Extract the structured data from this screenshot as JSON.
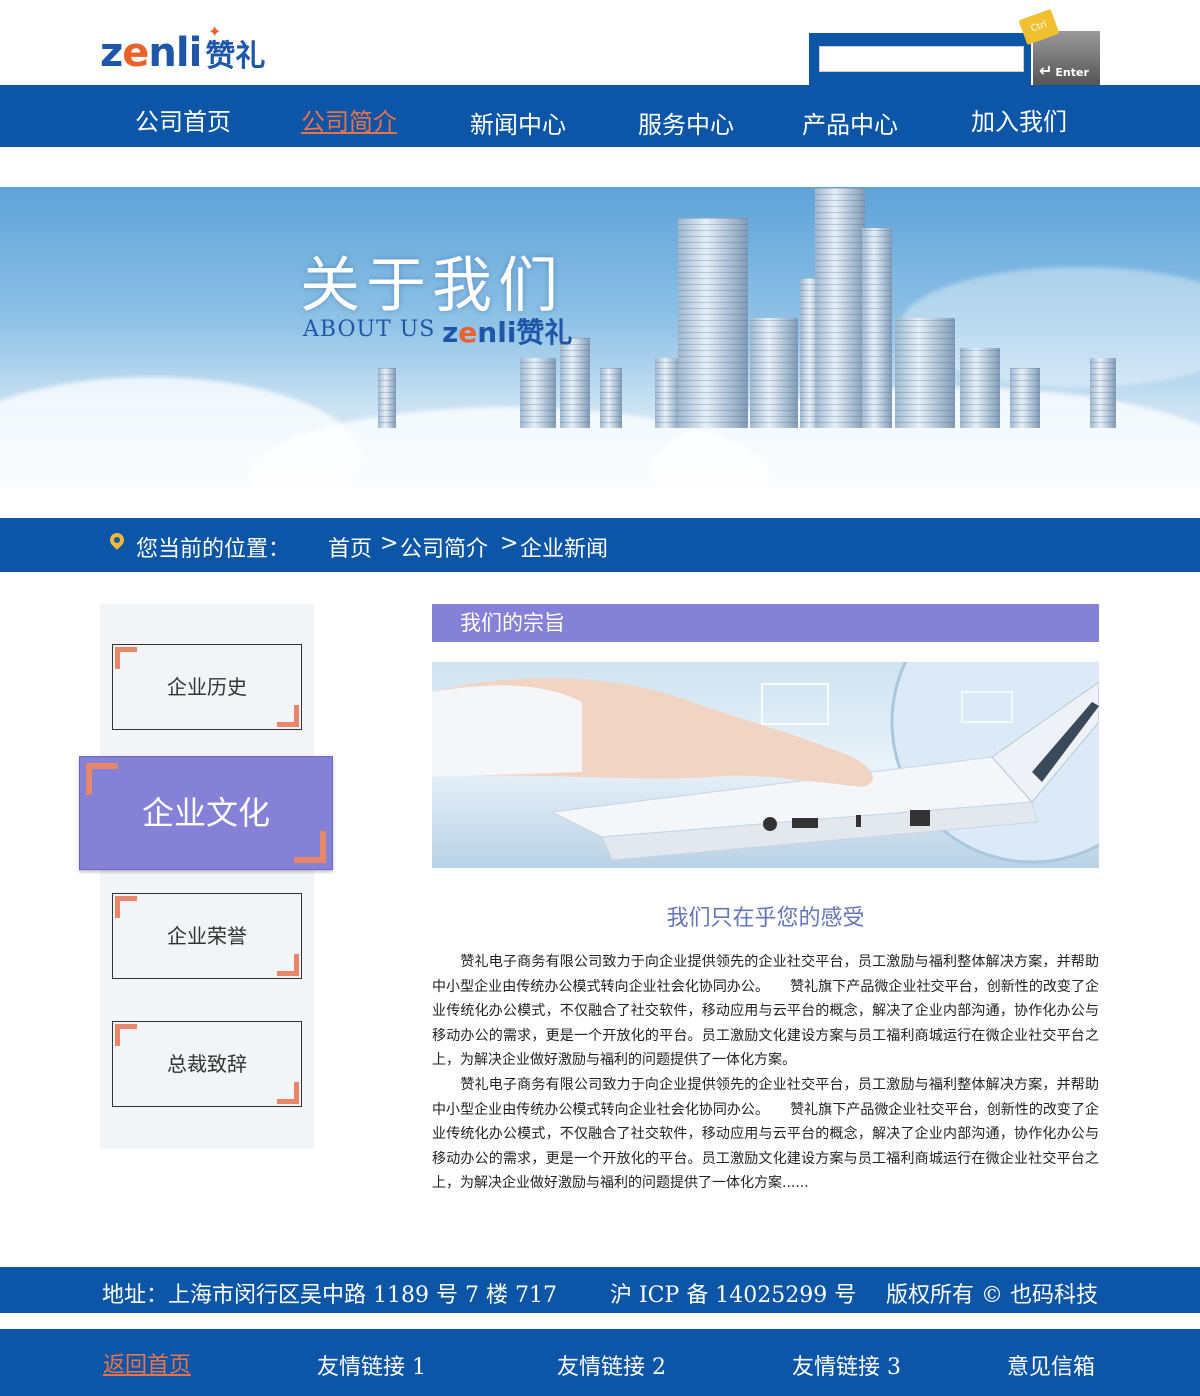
{
  "header": {
    "logo_en_pre": "z",
    "logo_en_ring": "e",
    "logo_en_post": "nli",
    "logo_cn": "赞礼",
    "search_placeholder": "",
    "ctrl_label": "Ctrl",
    "enter_label": "Enter"
  },
  "nav": {
    "items": [
      {
        "label": "公司首页"
      },
      {
        "label": "公司简介"
      },
      {
        "label": "新闻中心"
      },
      {
        "label": "服务中心"
      },
      {
        "label": "产品中心"
      },
      {
        "label": "加入我们"
      }
    ],
    "active_index": 1
  },
  "banner": {
    "title": "关于我们",
    "about": "ABOUT US",
    "logo_pre": "z",
    "logo_ring": "e",
    "logo_post": "nli赞礼"
  },
  "breadcrumb": {
    "label": "您当前的位置：",
    "items": [
      "首页",
      "公司简介",
      "企业新闻"
    ],
    "separator": ">"
  },
  "sidebar": {
    "items": [
      "企业历史",
      "企业文化",
      "企业荣誉",
      "总裁致辞"
    ],
    "active_index": 1
  },
  "content": {
    "section_title": "我们的宗旨",
    "subtitle": "我们只在乎您的感受",
    "paragraphs": [
      "　　赞礼电子商务有限公司致力于向企业提供领先的企业社交平台，员工激励与福利整体解决方案，并帮助中小型企业由传统办公模式转向企业社会化协同办公。　　赞礼旗下产品微企业社交平台，创新性的改变了企业传统化办公模式，不仅融合了社交软件，移动应用与云平台的概念，解决了企业内部沟通，协作化办公与移动办公的需求，更是一个开放化的平台。员工激励文化建设方案与员工福利商城运行在微企业社交平台之上，为解决企业做好激励与福利的问题提供了一体化方案。",
      "　　赞礼电子商务有限公司致力于向企业提供领先的企业社交平台，员工激励与福利整体解决方案，并帮助中小型企业由传统办公模式转向企业社会化协同办公。　　赞礼旗下产品微企业社交平台，创新性的改变了企业传统化办公模式，不仅融合了社交软件，移动应用与云平台的概念，解决了企业内部沟通，协作化办公与移动办公的需求，更是一个开放化的平台。员工激励文化建设方案与员工福利商城运行在微企业社交平台之上，为解决企业做好激励与福利的问题提供了一体化方案......"
    ]
  },
  "footer": {
    "address": "地址：上海市闵行区吴中路 1189 号 7 楼 717",
    "icp": "沪 ICP 备 14025299 号",
    "copyright": "版权所有 © 也码科技",
    "links": [
      "返回首页",
      "友情链接 1",
      "友情链接 2",
      "友情链接 3",
      "意见信箱"
    ],
    "active_index": 0
  },
  "colors": {
    "brand_blue": "#0d55a6",
    "accent_purple": "#8481d6",
    "accent_orange": "#e8724a"
  }
}
